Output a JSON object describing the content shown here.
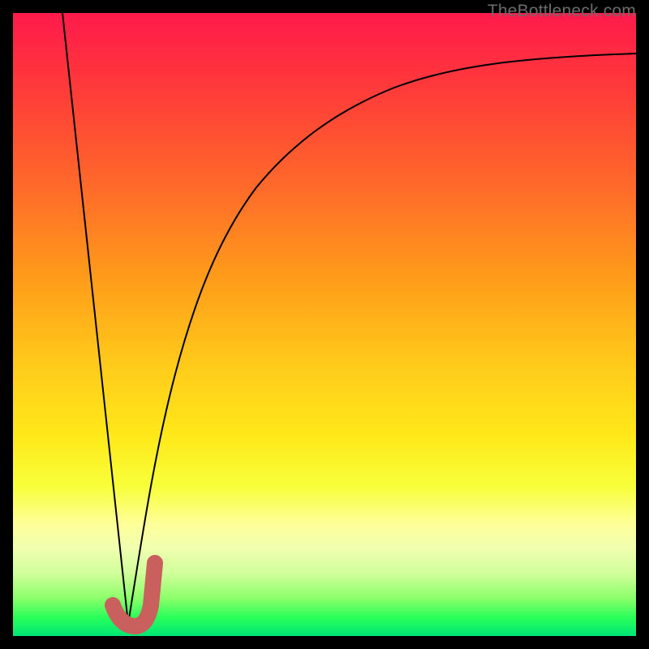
{
  "attribution": "TheBottleneck.com",
  "colors": {
    "background": "#000000",
    "gradient_top": "#ff1a4b",
    "gradient_bottom": "#00e676",
    "curve": "#000000",
    "marker": "#c9605e"
  },
  "chart_data": {
    "type": "line",
    "title": "",
    "xlabel": "",
    "ylabel": "",
    "xlim": [
      0,
      100
    ],
    "ylim": [
      0,
      100
    ],
    "grid": false,
    "legend": null,
    "series": [
      {
        "name": "left-falling-line",
        "x": [
          8,
          18.5
        ],
        "y": [
          100,
          2
        ]
      },
      {
        "name": "right-rising-curve",
        "x": [
          18.5,
          22,
          26,
          30,
          35,
          40,
          45,
          50,
          55,
          60,
          65,
          70,
          75,
          80,
          85,
          90,
          95,
          100
        ],
        "y": [
          2,
          25,
          42,
          54,
          64,
          71,
          76,
          80,
          83,
          85.5,
          87.5,
          89,
          90.2,
          91.2,
          92,
          92.6,
          93.1,
          93.5
        ]
      },
      {
        "name": "J-marker",
        "x": [
          16,
          17,
          18.5,
          20,
          21,
          22,
          22.5
        ],
        "y": [
          3.5,
          2,
          1.5,
          2,
          4,
          8,
          12
        ]
      }
    ],
    "annotations": [
      {
        "text": "TheBottleneck.com",
        "position": "top-right"
      }
    ]
  }
}
